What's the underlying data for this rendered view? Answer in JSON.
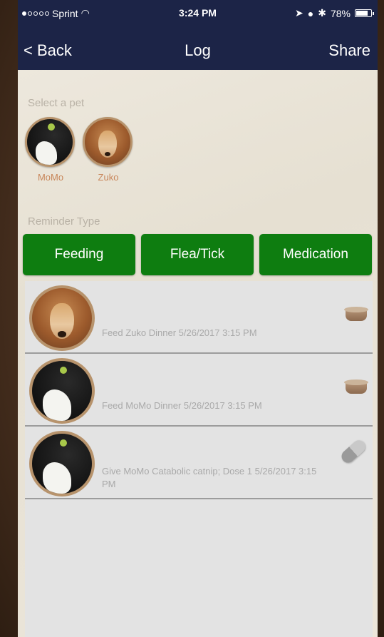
{
  "status_bar": {
    "carrier": "Sprint",
    "time": "3:24 PM",
    "battery": "78%",
    "battery_level": 0.78,
    "signal_dots": [
      true,
      false,
      false,
      false,
      false
    ]
  },
  "nav": {
    "back_label": "< Back",
    "title": "Log",
    "share_label": "Share"
  },
  "pets": {
    "label": "Select a pet",
    "items": [
      {
        "name": "MoMo",
        "avatar": "cat-photo"
      },
      {
        "name": "Zuko",
        "avatar": "dog-photo"
      }
    ]
  },
  "reminder": {
    "label": "Reminder Type",
    "types": [
      "Feeding",
      "Flea/Tick",
      "Medication"
    ]
  },
  "log": [
    {
      "text": "Feed Zuko Dinner 5/26/2017 3:15 PM",
      "avatar": "dog-photo",
      "icon": "bowl-icon"
    },
    {
      "text": "Feed MoMo Dinner 5/26/2017 3:15 PM",
      "avatar": "cat-photo",
      "icon": "bowl-icon"
    },
    {
      "text": "Give MoMo Catabolic catnip; Dose 1 5/26/2017 3:15 PM",
      "avatar": "cat-photo",
      "icon": "pill-icon"
    }
  ],
  "colors": {
    "nav_bg": "#1c2447",
    "button_green": "#0e7d10",
    "pet_name": "#c8865a"
  }
}
